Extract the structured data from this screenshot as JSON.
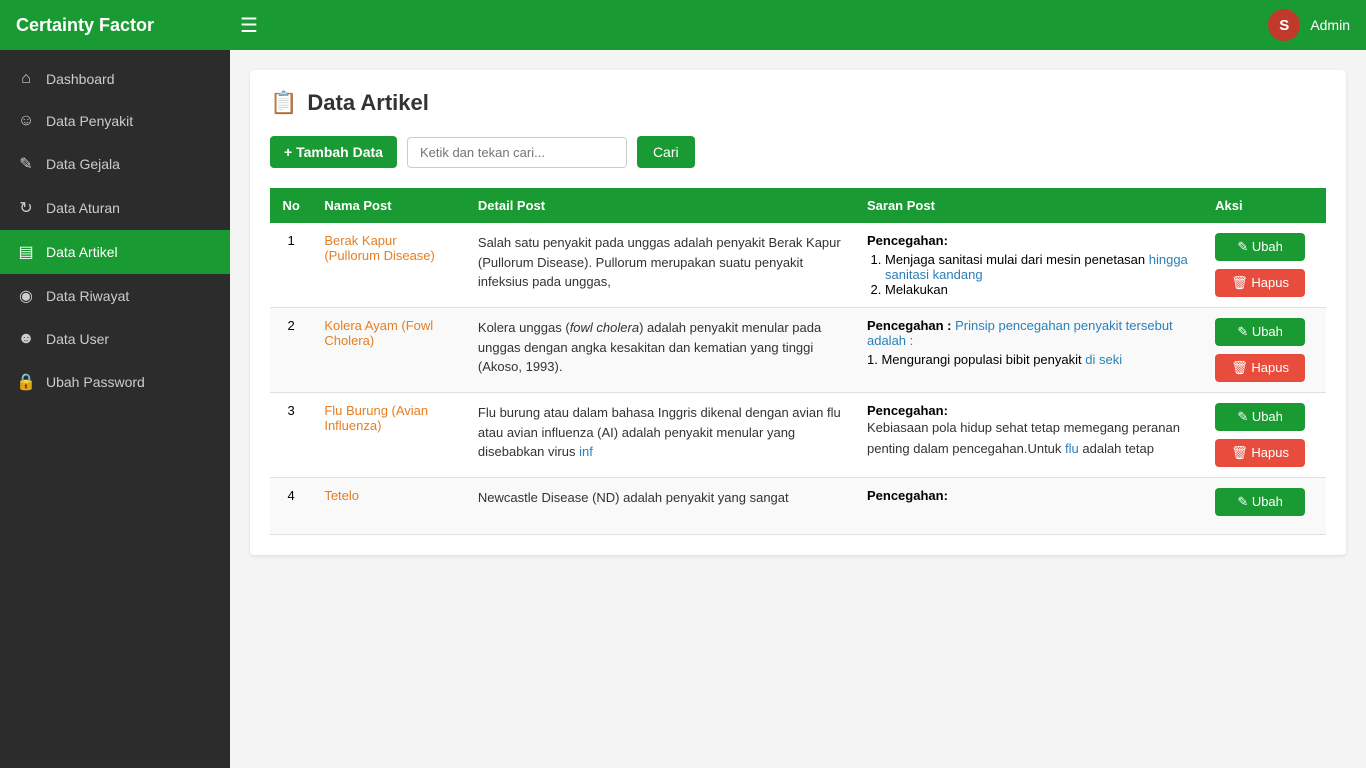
{
  "app": {
    "title": "Certainty Factor",
    "admin_initial": "S",
    "admin_name": "Admin"
  },
  "navbar": {
    "hamburger_icon": "☰",
    "avatar_initial": "S",
    "admin_label": "Admin"
  },
  "sidebar": {
    "items": [
      {
        "id": "dashboard",
        "label": "Dashboard",
        "icon": "⊞"
      },
      {
        "id": "data-penyakit",
        "label": "Data Penyakit",
        "icon": "👤"
      },
      {
        "id": "data-gejala",
        "label": "Data Gejala",
        "icon": "✏️"
      },
      {
        "id": "data-aturan",
        "label": "Data Aturan",
        "icon": "🔄"
      },
      {
        "id": "data-artikel",
        "label": "Data Artikel",
        "icon": "📋"
      },
      {
        "id": "data-riwayat",
        "label": "Data Riwayat",
        "icon": "⊙"
      },
      {
        "id": "data-user",
        "label": "Data User",
        "icon": "👤"
      },
      {
        "id": "ubah-password",
        "label": "Ubah Password",
        "icon": "🔒"
      }
    ]
  },
  "page": {
    "icon": "📋",
    "title": "Data Artikel"
  },
  "toolbar": {
    "add_label": "+ Tambah Data",
    "search_placeholder": "Ketik dan tekan cari...",
    "search_button": "Cari"
  },
  "table": {
    "headers": [
      "No",
      "Nama Post",
      "Detail Post",
      "Saran Post",
      "Aksi"
    ],
    "rows": [
      {
        "no": "1",
        "nama": "Berak Kapur (Pullorum Disease)",
        "detail": "Salah satu penyakit pada unggas adalah penyakit Berak Kapur (Pullorum Disease). Pullorum merupakan suatu penyakit infeksius pada unggas,",
        "detail_links": [],
        "saran_title": "Pencegahan:",
        "saran_list": [
          "Menjaga sanitasi mulai dari mesin penetasan hingga sanitasi kandang",
          "Melakukan"
        ],
        "saran_has_link": false
      },
      {
        "no": "2",
        "nama": "Kolera Ayam (Fowl Cholera)",
        "detail": "Kolera unggas (fowl cholera) adalah penyakit menular pada unggas dengan angka kesakitan dan kematian yang tinggi (Akoso, 1993).",
        "detail_links": [
          "fowl cholera"
        ],
        "saran_title": "Pencegahan :",
        "saran_prefix": "Prinsip pencegahan penyakit tersebut adalah :",
        "saran_list": [
          "Mengurangi populasi bibit penyakit di seki"
        ],
        "saran_has_link": true
      },
      {
        "no": "3",
        "nama": "Flu Burung (Avian Influenza)",
        "detail": "Flu burung atau dalam bahasa Inggris dikenal dengan avian flu atau avian influenza (AI) adalah penyakit menular yang disebabkan virus inf",
        "detail_links": [
          "inf"
        ],
        "saran_title": "Pencegahan:",
        "saran_body": "Kebiasaan pola hidup sehat tetap memegang peranan penting dalam pencegahan.Untuk flu adalah tetap",
        "saran_has_link": false
      },
      {
        "no": "4",
        "nama": "Tetelo",
        "detail": "Newcastle Disease (ND) adalah penyakit yang sangat",
        "saran_title": "Pencegahan:",
        "saran_has_link": false
      }
    ],
    "btn_ubah": "✏ Ubah",
    "btn_hapus": "🗑 Hapus"
  }
}
